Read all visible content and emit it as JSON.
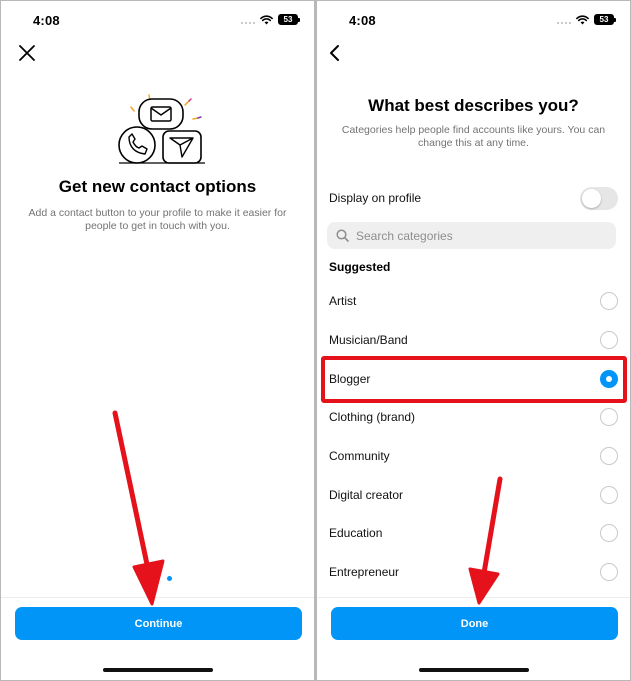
{
  "status_bar": {
    "time": "4:08",
    "battery": "53"
  },
  "left_screen": {
    "title": "Get new contact options",
    "description": "Add a contact button to your profile to make it easier for people to get in touch with you.",
    "continue_label": "Continue",
    "page_indicator": {
      "count": 3,
      "active_index": 2
    }
  },
  "right_screen": {
    "title": "What best describes you?",
    "subtitle": "Categories help people find accounts like yours. You can change this at any time.",
    "display_on_profile_label": "Display on profile",
    "display_on_profile_on": false,
    "search_placeholder": "Search categories",
    "suggested_label": "Suggested",
    "categories": [
      {
        "label": "Artist",
        "selected": false
      },
      {
        "label": "Musician/Band",
        "selected": false
      },
      {
        "label": "Blogger",
        "selected": true
      },
      {
        "label": "Clothing (brand)",
        "selected": false
      },
      {
        "label": "Community",
        "selected": false
      },
      {
        "label": "Digital creator",
        "selected": false
      },
      {
        "label": "Education",
        "selected": false
      },
      {
        "label": "Entrepreneur",
        "selected": false
      }
    ],
    "done_label": "Done"
  },
  "colors": {
    "accent": "#0095f6",
    "annotation_red": "#e5121b",
    "secondary_text": "#737373"
  },
  "icons": {
    "close": "close-icon",
    "back": "chevron-left-icon",
    "search": "search-icon",
    "wifi": "wifi-icon",
    "battery": "battery-icon",
    "illustration": [
      "phone-icon",
      "mail-icon",
      "send-icon"
    ]
  }
}
